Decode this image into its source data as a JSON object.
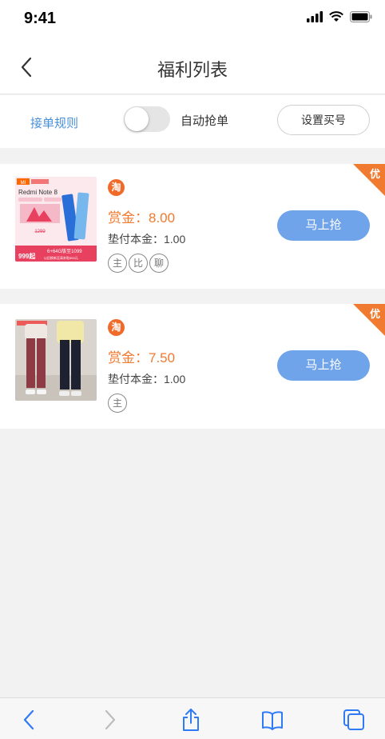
{
  "status": {
    "time": "9:41"
  },
  "nav": {
    "title": "福利列表"
  },
  "toolbar": {
    "rules_label": "接单规则",
    "auto_grab_label": "自动抢单",
    "auto_grab_on": false,
    "set_account_label": "设置买号"
  },
  "orders": [
    {
      "platform": "淘",
      "reward": "赏金：8.00",
      "principal": "垫付本金：1.00",
      "tags": [
        "主",
        "比",
        "聊"
      ],
      "button_label": "马上抢",
      "corner_label": "优",
      "product_image": {
        "brand": "MI",
        "model": "Redmi Note 8",
        "spec": "6+64G版至1099",
        "price": "999起",
        "strike_price": "1299",
        "note": "以旧换新至高补贴500元"
      }
    },
    {
      "platform": "淘",
      "reward": "赏金：7.50",
      "principal": "垫付本金：1.00",
      "tags": [
        "主"
      ],
      "button_label": "马上抢",
      "corner_label": "优"
    }
  ],
  "colors": {
    "accent": "#f07a2f",
    "button": "#6fa3ea",
    "link": "#4a90d9"
  },
  "bottom_bar": {
    "icons": [
      "back-icon",
      "forward-icon",
      "share-icon",
      "bookmarks-icon",
      "tabs-icon"
    ]
  }
}
